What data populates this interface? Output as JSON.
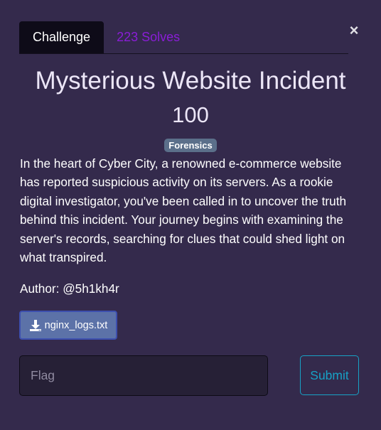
{
  "tabs": [
    {
      "label": "Challenge",
      "active": true
    },
    {
      "label": "223 Solves",
      "active": false
    }
  ],
  "close": {
    "label": "×",
    "icon": "close-icon"
  },
  "challenge": {
    "title": "Mysterious Website Incident",
    "points": "100",
    "category": "Forensics",
    "description": "In the heart of Cyber City, a renowned e-commerce website has reported suspicious activity on its servers. As a rookie digital investigator, you've been called in to uncover the truth behind this incident. Your journey begins with examining the server's records, searching for clues that could shed light on what transpired.",
    "author": "Author: @5h1kh4r"
  },
  "file": {
    "name": "nginx_logs.txt",
    "icon": "download-icon"
  },
  "flag": {
    "placeholder": "Flag",
    "value": ""
  },
  "submit_label": "Submit",
  "colors": {
    "background": "#342a4c",
    "active_tab": "#0e0b18",
    "inactive_tab_text": "#8a1dd6",
    "tag": "#5b6f8a",
    "file_button": "#5c72a8",
    "submit_accent": "#17a2c6"
  }
}
